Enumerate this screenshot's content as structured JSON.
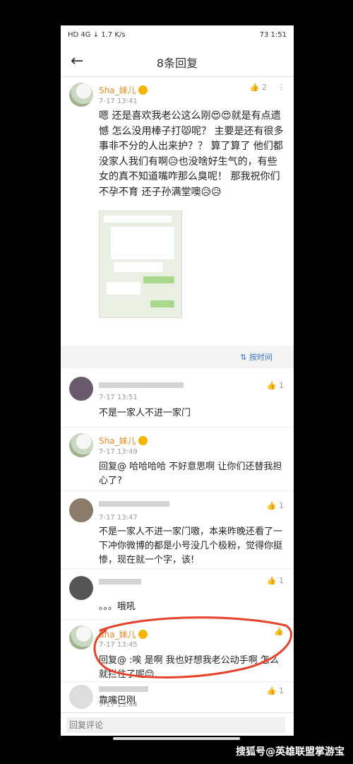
{
  "status": {
    "left": "HD 4G ↓ 1.7 K/s",
    "right": "73 1:51"
  },
  "header": {
    "title": "8条回复"
  },
  "main": {
    "user": "Sha_妹儿",
    "time": "7-17 13:41",
    "likes": "2",
    "text": "嗯 还是喜欢我老公这么刚😍😍就是有点遗憾 怎么没用棒子打😾呢？ 主要是还有很多事非不分的人出来护？？ 算了算了 他们都没家人我们有啊😥也没啥好生气的，有些女的真不知道嘴咋那么臭呢！ 那我祝你们不孕不育 还子孙满堂噢😥😥"
  },
  "sort": {
    "label": "按时间"
  },
  "replies": [
    {
      "time": "7-17 13:51",
      "likes": "1",
      "text": "不是一家人不进一家门"
    },
    {
      "user": "Sha_妹儿",
      "time": "7-17 13:49",
      "text": "回复@ 哈哈哈哈 不好意思啊 让你们还替我担心了?"
    },
    {
      "time": "7-17 13:47",
      "likes": "1",
      "text": "不是一家人不进一家门嗷，本来昨晚还看了一下冲你微博的都是小号没几个极粉，觉得你挺惨，现在就一个字，该!"
    },
    {
      "likes": "1",
      "text": "。。。哦吼"
    },
    {
      "user": "Sha_妹儿",
      "time": "7-17 13:45",
      "text": "回复@ :唉 是啊 我也好想我老公动手啊 怎么就拦住了呢😔"
    },
    {
      "time": "7-17 13:44",
      "likes": "1",
      "text": "靠嘴巴刚"
    }
  ],
  "input": {
    "placeholder": "回复评论"
  },
  "watermark": {
    "text": "搜狐号@英雄联盟掌游宝"
  },
  "icons": {
    "back": "back-arrow-icon",
    "like": "thumbs-up-icon",
    "more": "more-dots-icon",
    "sort": "sort-icon"
  }
}
